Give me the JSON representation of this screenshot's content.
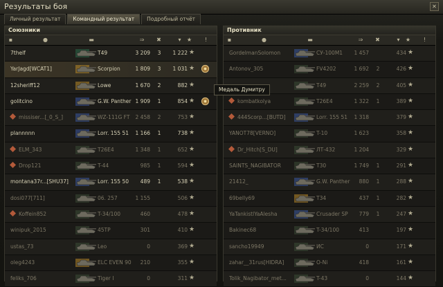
{
  "window": {
    "title": "Результаты боя"
  },
  "tabs": [
    {
      "label": "Личный результат",
      "active": false
    },
    {
      "label": "Командный результат",
      "active": true
    },
    {
      "label": "Подробный отчёт",
      "active": false
    }
  ],
  "allies": {
    "title": "Союзники",
    "rows": [
      {
        "player": "7thelf",
        "tank": "T49",
        "damage": "3 209",
        "kills": "3",
        "xp": "1 222",
        "mine": false,
        "dead": false,
        "squad": false,
        "medal": false,
        "tank_color": "#2c6a4a"
      },
      {
        "player": "YarJagd[WCAT1]",
        "tank": "Scorpion",
        "damage": "1 809",
        "kills": "3",
        "xp": "1 031",
        "mine": true,
        "dead": false,
        "squad": false,
        "medal": true,
        "tank_color": "#b98a2a"
      },
      {
        "player": "12sheriff12",
        "tank": "Lowe",
        "damage": "1 670",
        "kills": "2",
        "xp": "882",
        "mine": false,
        "dead": false,
        "squad": false,
        "medal": false,
        "tank_color": "#b98a2a"
      },
      {
        "player": "golitcino",
        "tank": "G.W. Panther",
        "damage": "1 909",
        "kills": "1",
        "xp": "854",
        "mine": false,
        "dead": false,
        "squad": false,
        "medal": true,
        "tank_color": "#3b57a0"
      },
      {
        "player": "missiser...[_0_S_]",
        "tank": "WZ-111G FT",
        "damage": "2 458",
        "kills": "2",
        "xp": "753",
        "mine": false,
        "dead": true,
        "squad": true,
        "medal": false,
        "tank_color": "#3b57a0"
      },
      {
        "player": "plannnnn",
        "tank": "Lorr. 155 51",
        "damage": "1 166",
        "kills": "1",
        "xp": "738",
        "mine": false,
        "dead": false,
        "squad": false,
        "medal": false,
        "tank_color": "#3b57a0"
      },
      {
        "player": "ELM_343",
        "tank": "T26E4",
        "damage": "1 348",
        "kills": "1",
        "xp": "652",
        "mine": false,
        "dead": true,
        "squad": true,
        "medal": false,
        "tank_color": "#3b4a34"
      },
      {
        "player": "Drop121",
        "tank": "T-44",
        "damage": "985",
        "kills": "1",
        "xp": "594",
        "mine": false,
        "dead": true,
        "squad": true,
        "medal": false,
        "tank_color": "#3b4a34"
      },
      {
        "player": "montana37r...[SHU37]",
        "tank": "Lorr. 155 50",
        "damage": "489",
        "kills": "1",
        "xp": "538",
        "mine": false,
        "dead": false,
        "squad": false,
        "medal": false,
        "tank_color": "#3b57a0"
      },
      {
        "player": "dosi077[711]",
        "tank": "06. 257",
        "damage": "1 155",
        "kills": "",
        "xp": "506",
        "mine": false,
        "dead": true,
        "squad": false,
        "medal": false,
        "tank_color": "#3b4a34"
      },
      {
        "player": "Koffein852",
        "tank": "T-34/100",
        "damage": "460",
        "kills": "",
        "xp": "478",
        "mine": false,
        "dead": true,
        "squad": true,
        "medal": false,
        "tank_color": "#3b4a34"
      },
      {
        "player": "winipuk_2015",
        "tank": "45TP",
        "damage": "301",
        "kills": "",
        "xp": "410",
        "mine": false,
        "dead": true,
        "squad": false,
        "medal": false,
        "tank_color": "#3b4a34"
      },
      {
        "player": "ustas_73",
        "tank": "Leo",
        "damage": "0",
        "kills": "",
        "xp": "369",
        "mine": false,
        "dead": true,
        "squad": false,
        "medal": false,
        "tank_color": "#3b4a34"
      },
      {
        "player": "oleg4243",
        "tank": "ELC EVEN 90",
        "damage": "210",
        "kills": "",
        "xp": "355",
        "mine": false,
        "dead": true,
        "squad": false,
        "medal": false,
        "tank_color": "#b98a2a"
      },
      {
        "player": "feliks_706",
        "tank": "Tiger I",
        "damage": "0",
        "kills": "",
        "xp": "311",
        "mine": false,
        "dead": true,
        "squad": false,
        "medal": false,
        "tank_color": "#3b4a34"
      }
    ]
  },
  "enemies": {
    "title": "Противник",
    "rows": [
      {
        "player": "GordelmanSolomon",
        "tank": "СУ-100М1",
        "damage": "1 457",
        "kills": "",
        "xp": "434",
        "dead": true,
        "squad": false,
        "tank_color": "#3b57a0"
      },
      {
        "player": "Antonov_305",
        "tank": "FV4202",
        "damage": "1 692",
        "kills": "2",
        "xp": "426",
        "dead": true,
        "squad": false,
        "tank_color": "#3b4a34"
      },
      {
        "player": "",
        "tank": "T49",
        "damage": "2 259",
        "kills": "2",
        "xp": "405",
        "dead": true,
        "squad": false,
        "tank_color": "#3b4a34"
      },
      {
        "player": "kombatkolya",
        "tank": "T26E4",
        "damage": "1 322",
        "kills": "1",
        "xp": "389",
        "dead": true,
        "squad": true,
        "tank_color": "#3b4a34"
      },
      {
        "player": "444Scorp...[BUTD]",
        "tank": "Lorr. 155 51",
        "damage": "1 318",
        "kills": "",
        "xp": "379",
        "dead": true,
        "squad": true,
        "tank_color": "#3b57a0"
      },
      {
        "player": "YANOT78[VERNO]",
        "tank": "T-10",
        "damage": "1 623",
        "kills": "",
        "xp": "358",
        "dead": true,
        "squad": false,
        "tank_color": "#3b4a34"
      },
      {
        "player": "Dr_Hitch[S_DU]",
        "tank": "ЛТ-432",
        "damage": "1 204",
        "kills": "",
        "xp": "329",
        "dead": true,
        "squad": true,
        "tank_color": "#3b4a34"
      },
      {
        "player": "SAINTS_NAGIBATOR",
        "tank": "T30",
        "damage": "1 749",
        "kills": "1",
        "xp": "291",
        "dead": true,
        "squad": false,
        "tank_color": "#3b4a34"
      },
      {
        "player": "21412_",
        "tank": "G.W. Panther",
        "damage": "880",
        "kills": "1",
        "xp": "288",
        "dead": true,
        "squad": false,
        "tank_color": "#3b57a0"
      },
      {
        "player": "69belly69",
        "tank": "T34",
        "damage": "437",
        "kills": "1",
        "xp": "282",
        "dead": true,
        "squad": false,
        "tank_color": "#b98a2a"
      },
      {
        "player": "YaTankistlYaAlesha",
        "tank": "Crusader SP",
        "damage": "779",
        "kills": "1",
        "xp": "247",
        "dead": true,
        "squad": false,
        "tank_color": "#3b57a0"
      },
      {
        "player": "Bakinec68",
        "tank": "T-34/100",
        "damage": "413",
        "kills": "",
        "xp": "197",
        "dead": true,
        "squad": false,
        "tank_color": "#3b4a34"
      },
      {
        "player": "sancho19949",
        "tank": "ИС",
        "damage": "0",
        "kills": "",
        "xp": "171",
        "dead": true,
        "squad": false,
        "tank_color": "#3b4a34"
      },
      {
        "player": "zahar__31rus[HIDRA]",
        "tank": "О-Ni",
        "damage": "418",
        "kills": "",
        "xp": "161",
        "dead": true,
        "squad": false,
        "tank_color": "#3b4a34"
      },
      {
        "player": "Tolik_Nagibator_met...",
        "tank": "T-43",
        "damage": "0",
        "kills": "",
        "xp": "144",
        "dead": true,
        "squad": false,
        "tank_color": "#3b4a34"
      }
    ]
  },
  "tooltip": {
    "text": "Медаль Думитру"
  },
  "icons": {
    "star": "★",
    "close": "✕"
  }
}
